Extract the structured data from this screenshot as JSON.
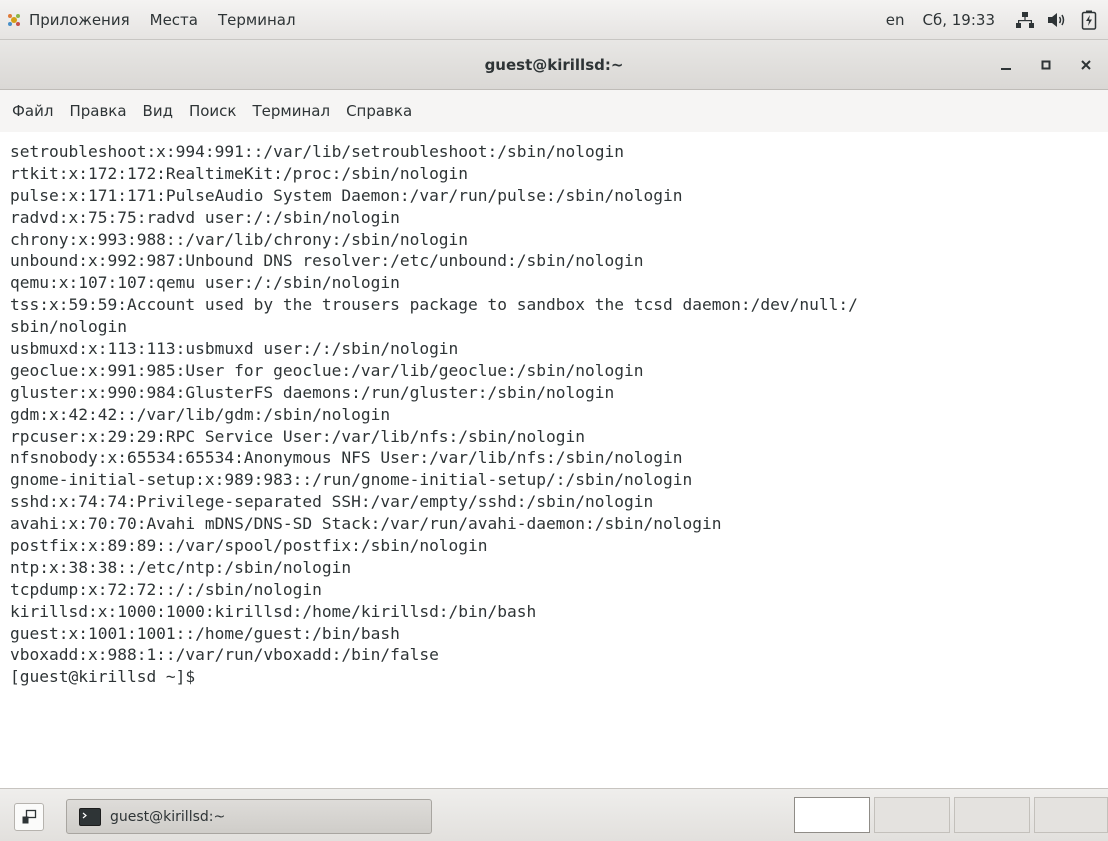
{
  "top_panel": {
    "apps_label": "Приложения",
    "places_label": "Места",
    "terminal_label": "Терминал",
    "keyboard_layout": "en",
    "clock": "Сб, 19:33",
    "icons": [
      "network-icon",
      "volume-icon",
      "battery-icon"
    ]
  },
  "window": {
    "title": "guest@kirillsd:~",
    "minimize_glyph": "_",
    "close_glyph": "×"
  },
  "menubar": {
    "file": "Файл",
    "edit": "Правка",
    "view": "Вид",
    "search": "Поиск",
    "terminal": "Терминал",
    "help": "Справка"
  },
  "terminal": {
    "lines": [
      "setroubleshoot:x:994:991::/var/lib/setroubleshoot:/sbin/nologin",
      "rtkit:x:172:172:RealtimeKit:/proc:/sbin/nologin",
      "pulse:x:171:171:PulseAudio System Daemon:/var/run/pulse:/sbin/nologin",
      "radvd:x:75:75:radvd user:/:/sbin/nologin",
      "chrony:x:993:988::/var/lib/chrony:/sbin/nologin",
      "unbound:x:992:987:Unbound DNS resolver:/etc/unbound:/sbin/nologin",
      "qemu:x:107:107:qemu user:/:/sbin/nologin",
      "tss:x:59:59:Account used by the trousers package to sandbox the tcsd daemon:/dev/null:/",
      "sbin/nologin",
      "usbmuxd:x:113:113:usbmuxd user:/:/sbin/nologin",
      "geoclue:x:991:985:User for geoclue:/var/lib/geoclue:/sbin/nologin",
      "gluster:x:990:984:GlusterFS daemons:/run/gluster:/sbin/nologin",
      "gdm:x:42:42::/var/lib/gdm:/sbin/nologin",
      "rpcuser:x:29:29:RPC Service User:/var/lib/nfs:/sbin/nologin",
      "nfsnobody:x:65534:65534:Anonymous NFS User:/var/lib/nfs:/sbin/nologin",
      "gnome-initial-setup:x:989:983::/run/gnome-initial-setup/:/sbin/nologin",
      "sshd:x:74:74:Privilege-separated SSH:/var/empty/sshd:/sbin/nologin",
      "avahi:x:70:70:Avahi mDNS/DNS-SD Stack:/var/run/avahi-daemon:/sbin/nologin",
      "postfix:x:89:89::/var/spool/postfix:/sbin/nologin",
      "ntp:x:38:38::/etc/ntp:/sbin/nologin",
      "tcpdump:x:72:72::/:/sbin/nologin",
      "kirillsd:x:1000:1000:kirillsd:/home/kirillsd:/bin/bash",
      "guest:x:1001:1001::/home/guest:/bin/bash",
      "vboxadd:x:988:1::/var/run/vboxadd:/bin/false",
      "[guest@kirillsd ~]$ "
    ]
  },
  "taskbar": {
    "task_label": "guest@kirillsd:~"
  }
}
